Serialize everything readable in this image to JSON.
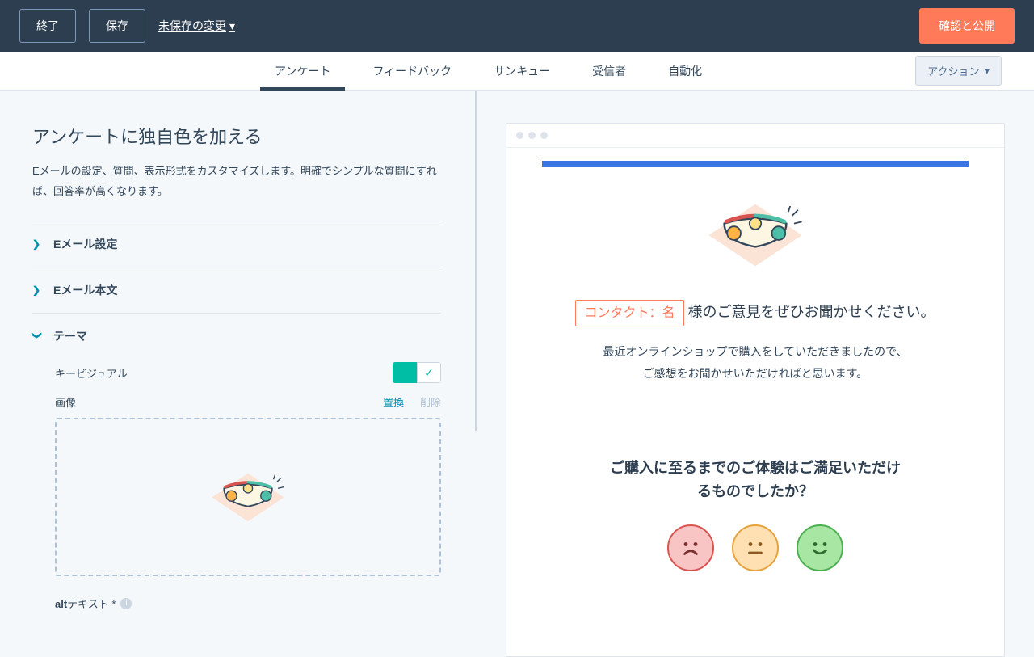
{
  "topbar": {
    "exit": "終了",
    "save": "保存",
    "unsaved": "未保存の変更",
    "publish": "確認と公開"
  },
  "tabs": {
    "items": [
      "アンケート",
      "フィードバック",
      "サンキュー",
      "受信者",
      "自動化"
    ],
    "actions": "アクション"
  },
  "left": {
    "title": "アンケートに独自色を加える",
    "subtitle": "Eメールの設定、質問、表示形式をカスタマイズします。明確でシンプルな質問にすれば、回答率が高くなります。",
    "sections": {
      "email_settings": "Eメール設定",
      "email_body": "Eメール本文",
      "theme": "テーマ"
    },
    "key_visual_label": "キービジュアル",
    "image_label": "画像",
    "replace": "置換",
    "delete": "削除",
    "alt_label": "altテキスト *"
  },
  "preview": {
    "token": "コンタクト：名",
    "greeting_suffix": " 様のご意見をぜひお聞かせください。",
    "body": "最近オンラインショップで購入をしていただきましたので、ご感想をお聞かせいただければと思います。",
    "question": "ご購入に至るまでのご体験はご満足いただけるものでしたか？"
  },
  "colors": {
    "primary": "#ff7a59",
    "teal": "#00bda5",
    "link": "#0091ae"
  }
}
